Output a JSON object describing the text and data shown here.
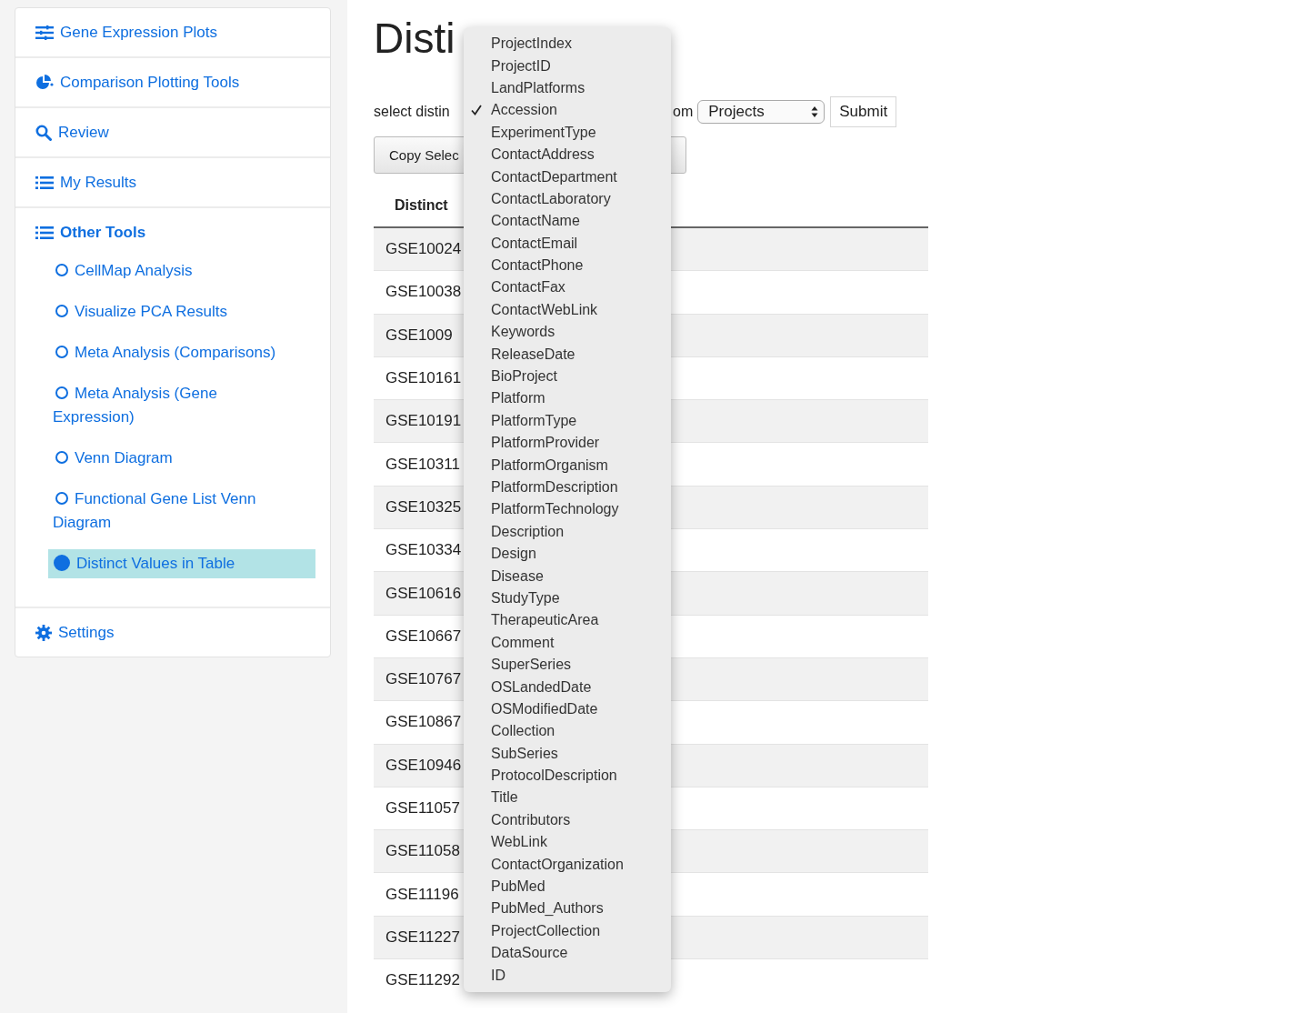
{
  "sidebar": {
    "items": [
      {
        "label": "Gene Expression Plots",
        "kind": "sliders"
      },
      {
        "label": "Comparison Plotting Tools",
        "kind": "pie"
      },
      {
        "label": "Review",
        "kind": "search"
      },
      {
        "label": "My Results",
        "kind": "list"
      },
      {
        "label": "Other Tools",
        "kind": "list",
        "children": [
          {
            "label": "CellMap Analysis",
            "selected": false
          },
          {
            "label": "Visualize PCA Results",
            "selected": false
          },
          {
            "label": "Meta Analysis (Comparisons)",
            "selected": false
          },
          {
            "label": "Meta Analysis (Gene Expression)",
            "selected": false
          },
          {
            "label": "Venn Diagram",
            "selected": false
          },
          {
            "label": "Functional Gene List Venn Diagram",
            "selected": false
          },
          {
            "label": "Distinct Values in Table",
            "selected": true
          }
        ]
      },
      {
        "label": "Settings",
        "kind": "gear"
      }
    ]
  },
  "page": {
    "title": "Disti",
    "query": {
      "prefix": "select distin",
      "suffix": "om",
      "table_select": "Projects",
      "submit": "Submit"
    },
    "copy_button": "Copy Selec",
    "table": {
      "columns": [
        "Distinct"
      ],
      "rows": [
        "GSE10024",
        "GSE10038",
        "GSE1009",
        "GSE10161",
        "GSE10191",
        "GSE10311",
        "GSE10325",
        "GSE10334",
        "GSE10616",
        "GSE10667",
        "GSE10767",
        "GSE10867",
        "GSE10946",
        "GSE11057",
        "GSE11058",
        "GSE11196",
        "GSE11227",
        "GSE11292"
      ]
    }
  },
  "column_menu": {
    "items": [
      {
        "label": "ProjectIndex",
        "selected": false
      },
      {
        "label": "ProjectID",
        "selected": false
      },
      {
        "label": "LandPlatforms",
        "selected": false
      },
      {
        "label": "Accession",
        "selected": true
      },
      {
        "label": "ExperimentType",
        "selected": false
      },
      {
        "label": "ContactAddress",
        "selected": false
      },
      {
        "label": "ContactDepartment",
        "selected": false
      },
      {
        "label": "ContactLaboratory",
        "selected": false
      },
      {
        "label": "ContactName",
        "selected": false
      },
      {
        "label": "ContactEmail",
        "selected": false
      },
      {
        "label": "ContactPhone",
        "selected": false
      },
      {
        "label": "ContactFax",
        "selected": false
      },
      {
        "label": "ContactWebLink",
        "selected": false
      },
      {
        "label": "Keywords",
        "selected": false
      },
      {
        "label": "ReleaseDate",
        "selected": false
      },
      {
        "label": "BioProject",
        "selected": false
      },
      {
        "label": "Platform",
        "selected": false
      },
      {
        "label": "PlatformType",
        "selected": false
      },
      {
        "label": "PlatformProvider",
        "selected": false
      },
      {
        "label": "PlatformOrganism",
        "selected": false
      },
      {
        "label": "PlatformDescription",
        "selected": false
      },
      {
        "label": "PlatformTechnology",
        "selected": false
      },
      {
        "label": "Description",
        "selected": false
      },
      {
        "label": "Design",
        "selected": false
      },
      {
        "label": "Disease",
        "selected": false
      },
      {
        "label": "StudyType",
        "selected": false
      },
      {
        "label": "TherapeuticArea",
        "selected": false
      },
      {
        "label": "Comment",
        "selected": false
      },
      {
        "label": "SuperSeries",
        "selected": false
      },
      {
        "label": "OSLandedDate",
        "selected": false
      },
      {
        "label": "OSModifiedDate",
        "selected": false
      },
      {
        "label": "Collection",
        "selected": false
      },
      {
        "label": "SubSeries",
        "selected": false
      },
      {
        "label": "ProtocolDescription",
        "selected": false
      },
      {
        "label": "Title",
        "selected": false
      },
      {
        "label": "Contributors",
        "selected": false
      },
      {
        "label": "WebLink",
        "selected": false
      },
      {
        "label": "ContactOrganization",
        "selected": false
      },
      {
        "label": "PubMed",
        "selected": false
      },
      {
        "label": "PubMed_Authors",
        "selected": false
      },
      {
        "label": "ProjectCollection",
        "selected": false
      },
      {
        "label": "DataSource",
        "selected": false
      },
      {
        "label": "ID",
        "selected": false
      }
    ]
  }
}
